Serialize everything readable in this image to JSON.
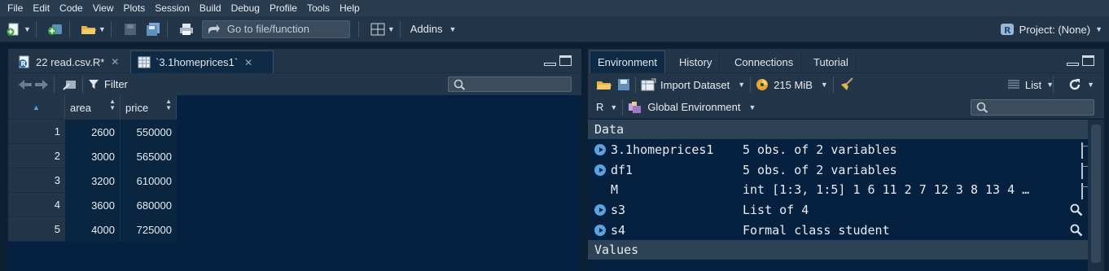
{
  "menu": [
    "File",
    "Edit",
    "Code",
    "View",
    "Plots",
    "Session",
    "Build",
    "Debug",
    "Profile",
    "Tools",
    "Help"
  ],
  "toolbar": {
    "goto_placeholder": "Go to file/function",
    "addins_label": "Addins",
    "project_label": "Project: (None)"
  },
  "source_pane": {
    "tabs": [
      {
        "label": "22 read.csv.R*",
        "icon": "r-script-icon"
      },
      {
        "label": "`3.1homeprices1`",
        "icon": "table-icon"
      }
    ],
    "filter_label": "Filter",
    "columns": [
      "area",
      "price"
    ],
    "rows": [
      {
        "n": "1",
        "area": "2600",
        "price": "550000"
      },
      {
        "n": "2",
        "area": "3000",
        "price": "565000"
      },
      {
        "n": "3",
        "area": "3200",
        "price": "610000"
      },
      {
        "n": "4",
        "area": "3600",
        "price": "680000"
      },
      {
        "n": "5",
        "area": "4000",
        "price": "725000"
      }
    ]
  },
  "env_pane": {
    "tabs": [
      "Environment",
      "History",
      "Connections",
      "Tutorial"
    ],
    "import_label": "Import Dataset",
    "memory_label": "215 MiB",
    "list_label": "List",
    "lang_label": "R",
    "scope_label": "Global Environment",
    "data_section": "Data",
    "values_section": "Values",
    "data_items": [
      {
        "name": "3.1homeprices1",
        "value": "5 obs. of 2 variables",
        "expandable": true,
        "action": "table-icon"
      },
      {
        "name": "df1",
        "value": "5 obs. of 2 variables",
        "expandable": true,
        "action": "table-icon"
      },
      {
        "name": "M",
        "value": "int [1:3, 1:5] 1 6 11 2 7 12 3 8 13 4 …",
        "expandable": false,
        "action": "table-icon"
      },
      {
        "name": "s3",
        "value": "List of  4",
        "expandable": true,
        "action": "magnifier-icon"
      },
      {
        "name": "s4",
        "value": "Formal class  student",
        "expandable": true,
        "action": "magnifier-icon"
      }
    ]
  },
  "colors": {
    "background": "#062040",
    "toolbar": "#223549",
    "accent": "#5aa2e0"
  }
}
